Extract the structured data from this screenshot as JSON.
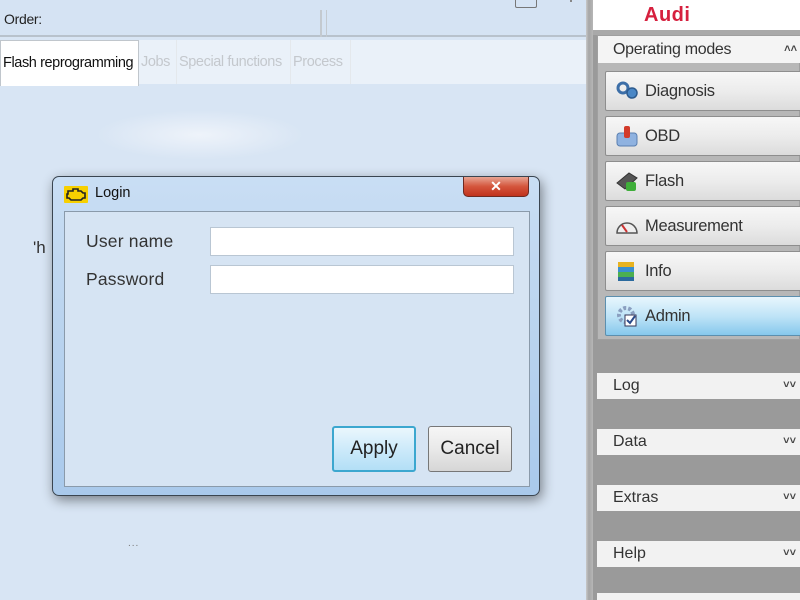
{
  "order": {
    "label": "Order:"
  },
  "tabs": [
    {
      "label": "Flash reprogramming",
      "active": true
    },
    {
      "label": "Jobs",
      "active": false
    },
    {
      "label": "Special functions",
      "active": false
    },
    {
      "label": "Process",
      "active": false
    }
  ],
  "background": {
    "partial_text": "'h",
    "ellipsis": "..."
  },
  "brand": {
    "name": "Audi",
    "color": "#d6203e"
  },
  "operating_modes": {
    "title": "Operating modes",
    "collapse_icon": "double-chevron-up-icon",
    "items": [
      {
        "label": "Diagnosis",
        "icon": "stethoscope-icon",
        "active": false
      },
      {
        "label": "OBD",
        "icon": "obd-connector-icon",
        "active": false
      },
      {
        "label": "Flash",
        "icon": "flash-chip-icon",
        "active": false
      },
      {
        "label": "Measurement",
        "icon": "gauge-icon",
        "active": false
      },
      {
        "label": "Info",
        "icon": "books-icon",
        "active": false
      },
      {
        "label": "Admin",
        "icon": "gear-check-icon",
        "active": true
      }
    ]
  },
  "sections": [
    {
      "label": "Log",
      "icon": "double-chevron-down-icon"
    },
    {
      "label": "Data",
      "icon": "double-chevron-down-icon"
    },
    {
      "label": "Extras",
      "icon": "double-chevron-down-icon"
    },
    {
      "label": "Help",
      "icon": "double-chevron-down-icon"
    }
  ],
  "dialog": {
    "title": "Login",
    "title_icon": "engine-warning-icon",
    "close_label": "✕",
    "fields": [
      {
        "label": "User name",
        "value": "",
        "placeholder": ""
      },
      {
        "label": "Password",
        "value": "",
        "placeholder": ""
      }
    ],
    "apply_label": "Apply",
    "cancel_label": "Cancel"
  }
}
